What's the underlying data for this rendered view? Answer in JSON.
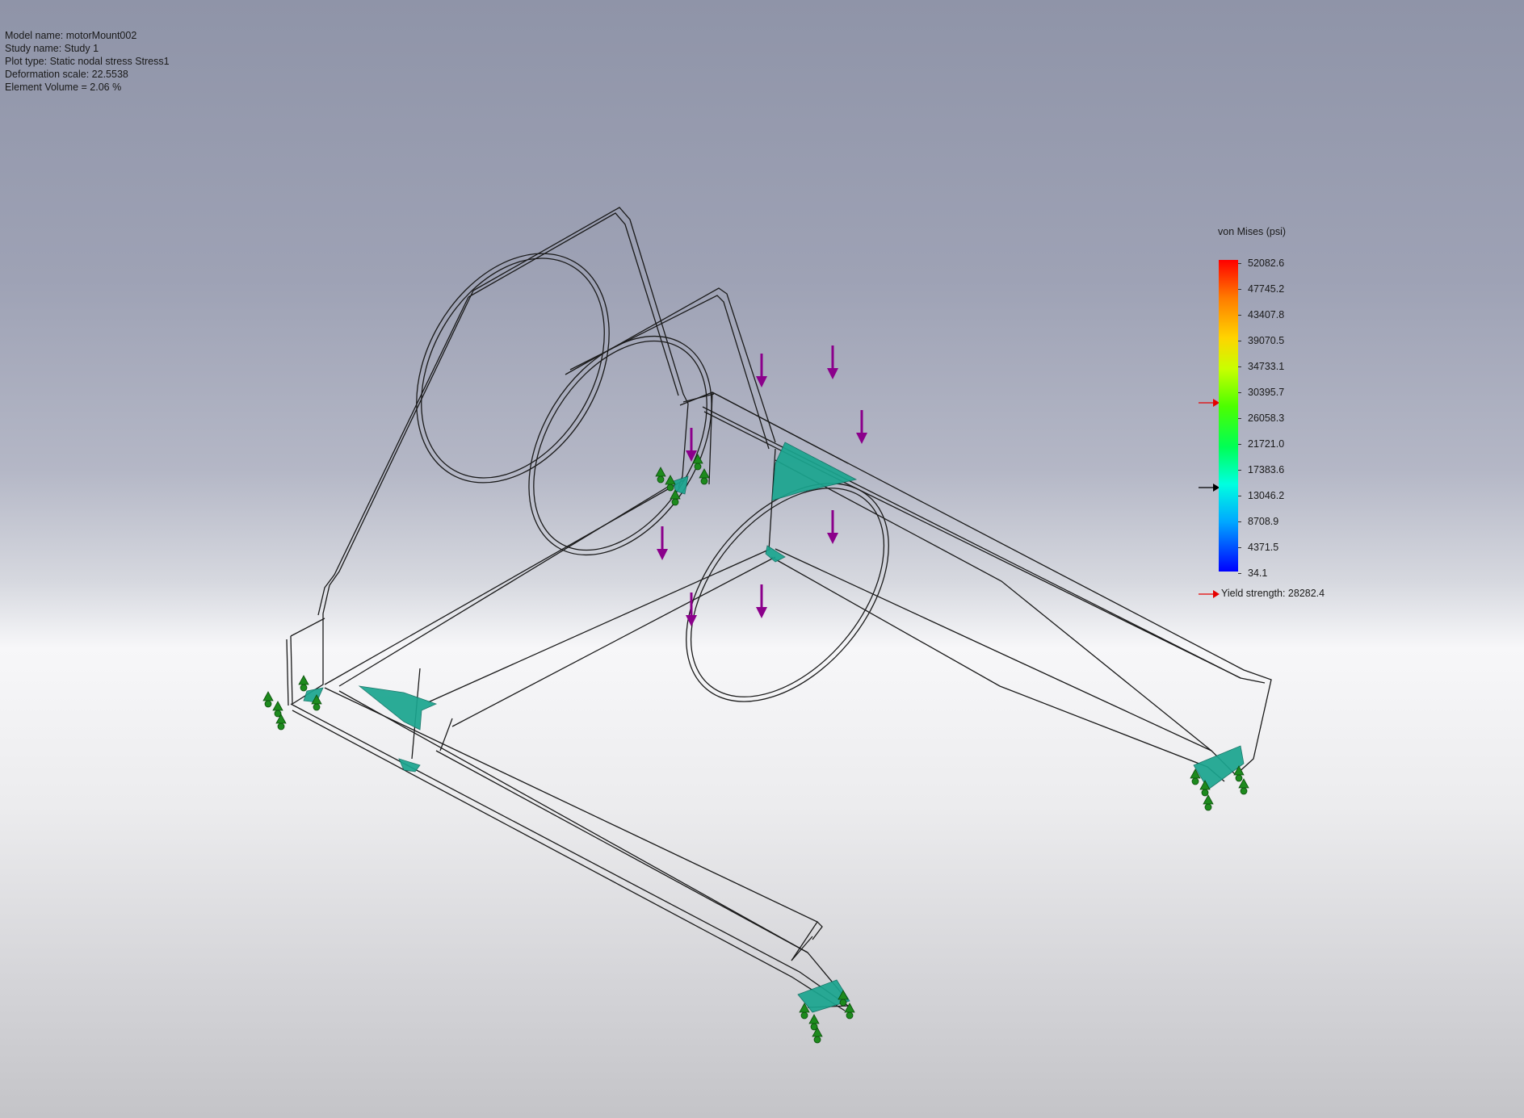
{
  "info": {
    "model_name": "Model name: motorMount002",
    "study_name": "Study name: Study 1",
    "plot_type": "Plot type: Static nodal stress Stress1",
    "deformation_scale": "Deformation scale: 22.5538",
    "element_volume": "Element Volume = 2.06 %"
  },
  "legend": {
    "title": "von Mises (psi)",
    "ticks": [
      "52082.6",
      "47745.2",
      "43407.8",
      "39070.5",
      "34733.1",
      "30395.7",
      "26058.3",
      "21721.0",
      "17383.6",
      "13046.2",
      "8708.9",
      "4371.5",
      "34.1"
    ],
    "yield_label": "Yield strength: 28282.4",
    "yield_marker_color": "#e60000",
    "current_marker_color": "#000000"
  },
  "colors": {
    "load_arrow": "#8b008b",
    "fixture": "#1d8a1d",
    "stress_patch": "#1aa58f",
    "wireframe": "#1a1a1a"
  }
}
